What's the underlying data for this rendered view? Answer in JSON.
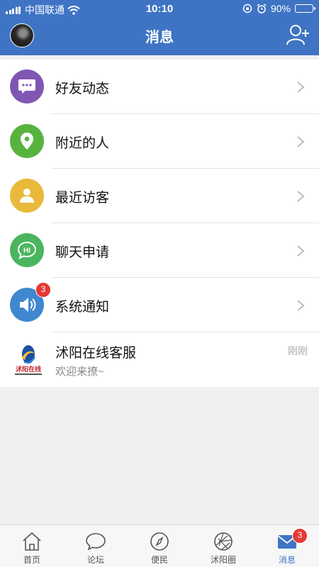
{
  "status_bar": {
    "carrier": "中国联通",
    "time": "10:10",
    "battery": "90%",
    "battery_level": 0.9
  },
  "header": {
    "title": "消息"
  },
  "menu": [
    {
      "label": "好友动态",
      "color": "#7f57b3",
      "icon": "chat-dots-icon"
    },
    {
      "label": "附近的人",
      "color": "#57b33e",
      "icon": "location-pin-icon"
    },
    {
      "label": "最近访客",
      "color": "#e8b93a",
      "icon": "person-icon"
    },
    {
      "label": "聊天申请",
      "color": "#4ab55e",
      "icon": "hi-bubble-icon"
    },
    {
      "label": "系统通知",
      "color": "#3f88cf",
      "icon": "speaker-icon",
      "badge": "3"
    }
  ],
  "service_chat": {
    "name": "沭阳在线客服",
    "message": "欢迎来撩~",
    "time": "刚刚",
    "logo_text": "沭阳在线"
  },
  "tabbar": [
    {
      "label": "首页",
      "icon": "home-icon"
    },
    {
      "label": "论坛",
      "icon": "forum-icon"
    },
    {
      "label": "便民",
      "icon": "compass-icon"
    },
    {
      "label": "沭阳圈",
      "icon": "aperture-icon"
    },
    {
      "label": "消息",
      "icon": "mail-icon",
      "badge": "3",
      "active": true
    }
  ]
}
